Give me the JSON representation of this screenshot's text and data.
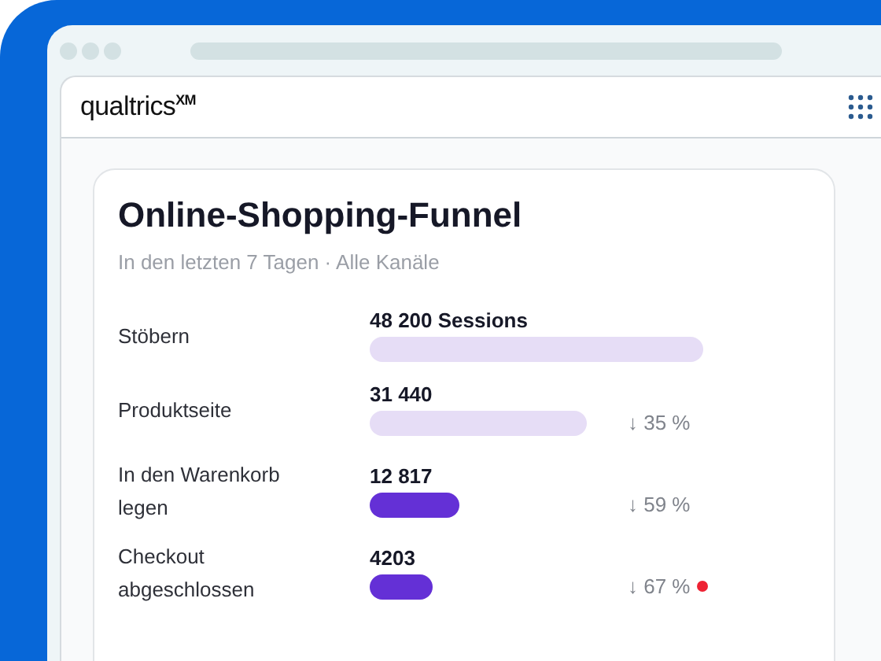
{
  "logo": "qualtrics$^{XM}$",
  "card": {
    "title": "Online-Shopping-Funnel",
    "subtitle": "In den letzten 7 Tagen · Alle Kanäle",
    "steps": [
      {
        "label": "Stöbern",
        "value": "48 200 Sessions",
        "highlight": false
      },
      {
        "label": "Produktseite",
        "value": "31 440",
        "highlight": false,
        "drop": "↓ 35 %"
      },
      {
        "label": "In den Warenkorb legen",
        "value": "12 817",
        "highlight": true,
        "drop": "↓ 59 %"
      },
      {
        "label": "Checkout abgeschlossen",
        "value": "4203",
        "highlight": true,
        "drop": "↓ 67 %",
        "alert": true
      }
    ]
  }
}
